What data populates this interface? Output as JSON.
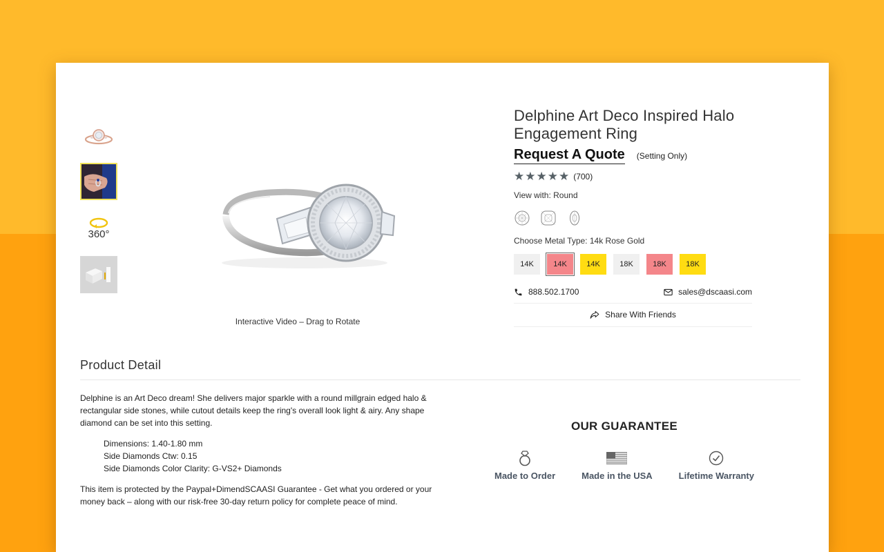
{
  "product": {
    "title": "Delphine Art Deco Inspired Halo Engagement Ring",
    "price_label": "Request A Quote",
    "price_note": "(Setting Only)",
    "rating": {
      "stars": 5,
      "count": "(700)"
    },
    "view_with": "View with: Round",
    "shapes": [
      "round-shape-icon",
      "cushion-shape-icon",
      "oval-shape-icon"
    ],
    "metal_label": "Choose Metal Type: 14k Rose Gold",
    "metals": [
      {
        "label": "14K",
        "color": "#f0f0f0",
        "selected": false
      },
      {
        "label": "14K",
        "color": "#f4868a",
        "selected": true
      },
      {
        "label": "14K",
        "color": "#ffdc12",
        "selected": false
      },
      {
        "label": "18K",
        "color": "#f0f0f0",
        "selected": false
      },
      {
        "label": "18K",
        "color": "#f4868a",
        "selected": false
      },
      {
        "label": "18K",
        "color": "#ffdc12",
        "selected": false
      }
    ],
    "phone": "888.502.1700",
    "email": "sales@dscaasi.com",
    "share": "Share With Friends"
  },
  "gallery": {
    "thumb_360_label": "360°",
    "video_caption": "Interactive Video – Drag to Rotate"
  },
  "detail": {
    "heading": "Product Detail",
    "description": "Delphine is an Art Deco dream! She delivers major sparkle with a round millgrain edged halo & rectangular side stones, while cutout details keep the ring's overall look light & airy. Any shape diamond can be set into this setting.",
    "specs": [
      "Dimensions: 1.40-1.80 mm",
      "Side Diamonds Ctw: 0.15",
      "Side Diamonds Color Clarity: G-VS2+ Diamonds"
    ],
    "guarantee_text": "This item is protected by the Paypal+DimendSCAASI Guarantee - Get what you ordered or your money back – along with our risk-free 30-day return policy for complete peace of mind."
  },
  "guarantee": {
    "title": "OUR GUARANTEE",
    "items": [
      "Made to Order",
      "Made in the USA",
      "Lifetime Warranty"
    ]
  },
  "colors": {
    "background_top": "#ffba2b",
    "background_bottom": "#ffa20f",
    "rose_swatch": "#f4868a",
    "yellow_swatch": "#ffdc12",
    "white_swatch": "#f0f0f0",
    "guarantee_label": "#4a5563"
  }
}
